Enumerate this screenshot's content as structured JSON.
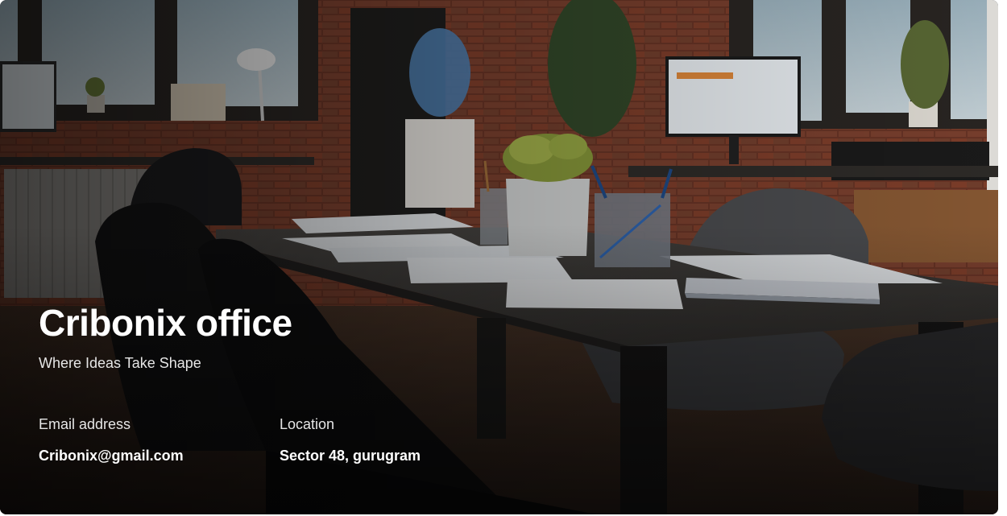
{
  "office": {
    "title": "Cribonix office",
    "tagline": "Where Ideas Take Shape"
  },
  "contact": {
    "email_label": "Email address",
    "email_value": "Cribonix@gmail.com",
    "location_label": "Location",
    "location_value": "Sector 48, gurugram"
  },
  "colors": {
    "text_primary": "#ffffff",
    "text_secondary": "#e6e6e6",
    "brick": "#6e3a2a",
    "table": "#3a3836"
  }
}
